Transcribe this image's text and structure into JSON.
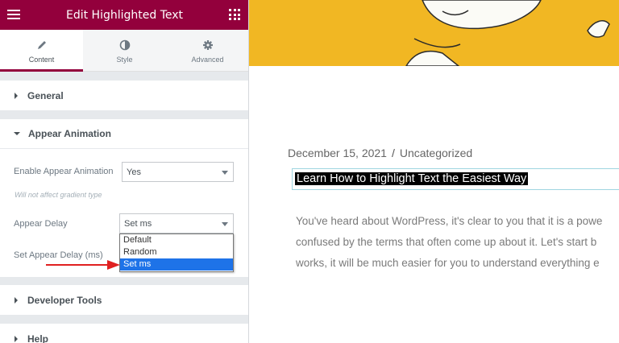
{
  "editor": {
    "title": "Edit Highlighted Text",
    "accent_color": "#93003c",
    "tabs": [
      {
        "label": "Content",
        "icon": "pencil-icon"
      },
      {
        "label": "Style",
        "icon": "half-circle-icon"
      },
      {
        "label": "Advanced",
        "icon": "gear-icon"
      }
    ],
    "sections": {
      "general": "General",
      "appear_animation": "Appear Animation",
      "developer_tools": "Developer Tools",
      "help": "Help"
    },
    "controls": {
      "enable_label": "Enable Appear Animation",
      "enable_value": "Yes",
      "note": "Will not affect gradient type",
      "delay_label": "Appear Delay",
      "delay_value": "Set ms",
      "set_delay_label": "Set Appear Delay (ms)",
      "delay_options": [
        "Default",
        "Random",
        "Set ms"
      ],
      "delay_selected": "Set ms"
    }
  },
  "preview": {
    "date": "December 15, 2021",
    "separator": "/",
    "category": "Uncategorized",
    "post_title": "Learn How to Highlight Text the Easiest Way",
    "paragraph_lines": [
      "You've heard about WordPress, it's clear to you that it is a powe",
      "confused by the terms that often come up about it. Let's start b",
      "works, it will be much easier for you to understand everything e"
    ],
    "hero_color": "#f1b723"
  },
  "annotation": {
    "arrow_color": "#e02020"
  }
}
